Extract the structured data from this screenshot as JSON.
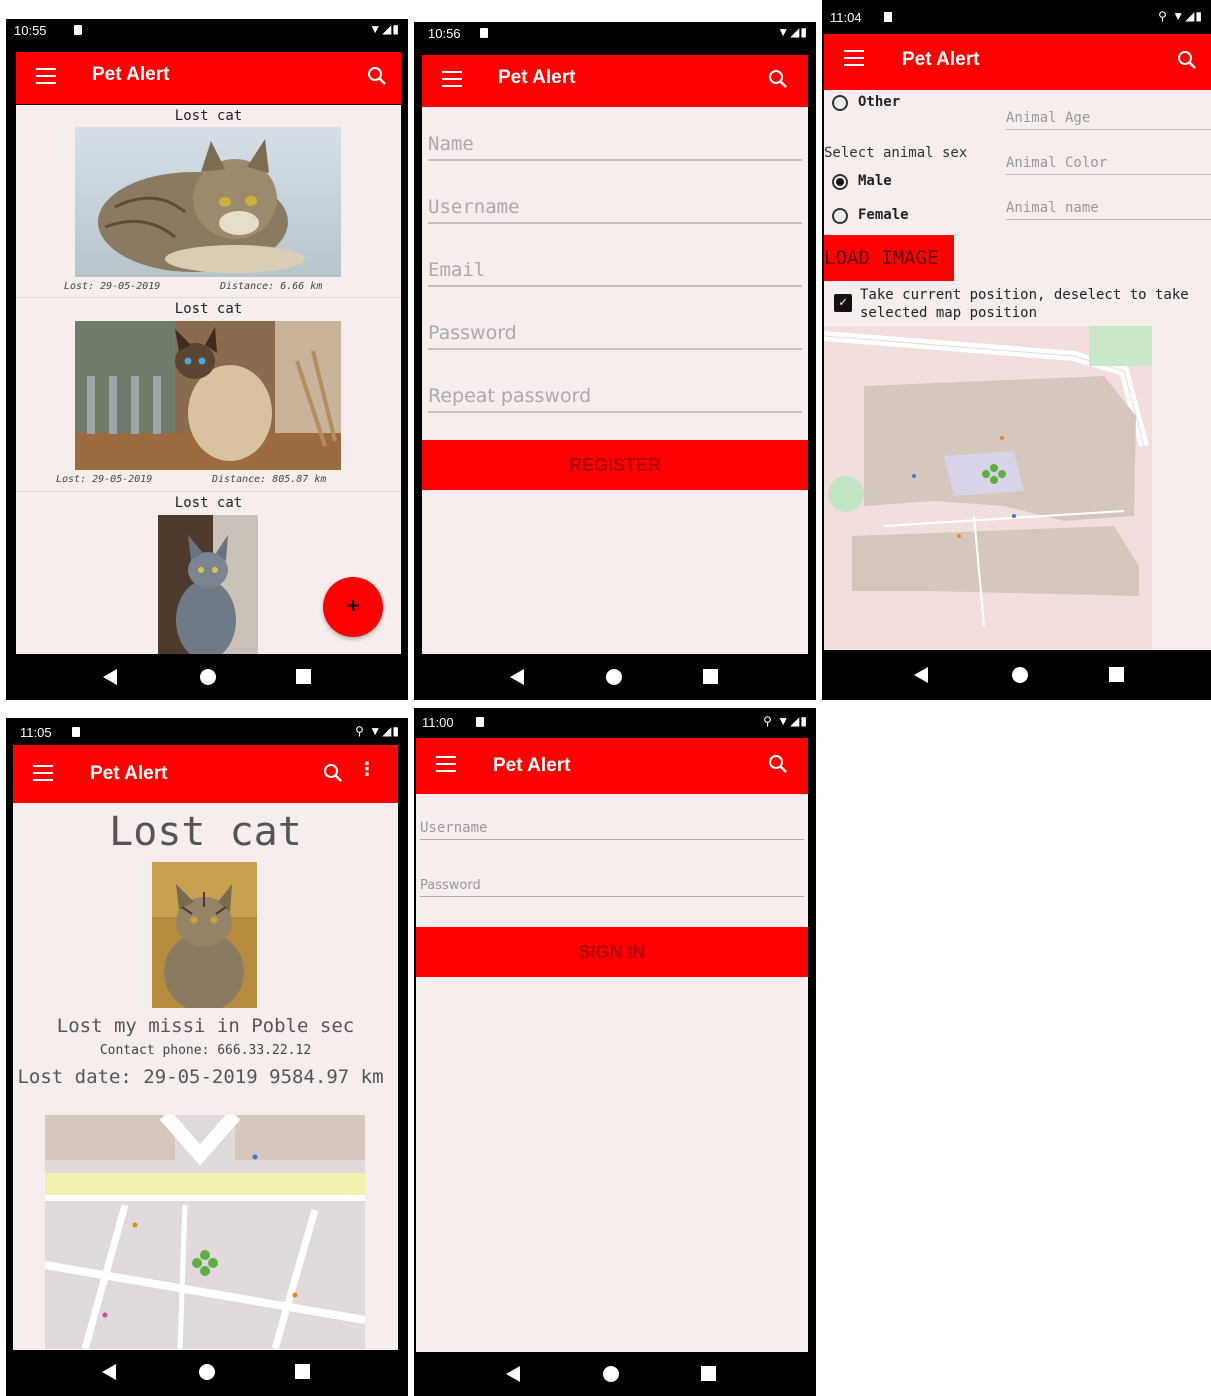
{
  "app_title": "Pet Alert",
  "status_icons": "▼◢▮",
  "status_icons_loc": "⚲ ▼◢▮",
  "screens": {
    "list": {
      "time": "10:55",
      "cards": [
        {
          "title": "Lost cat",
          "lost": "Lost: 29-05-2019",
          "distance": "Distance: 6.66 km"
        },
        {
          "title": "Lost cat",
          "lost": "Lost: 29-05-2019",
          "distance": "Distance: 805.87 km"
        },
        {
          "title": "Lost cat"
        }
      ],
      "fab_label": "+"
    },
    "register": {
      "time": "10:56",
      "placeholders": {
        "name": "Name",
        "username": "Username",
        "email": "Email",
        "password": "Password",
        "repeat_password": "Repeat password"
      },
      "button": "REGISTER"
    },
    "report": {
      "time": "11:04",
      "radio_other": "Other",
      "sex_label": "Select animal sex",
      "radio_male": "Male",
      "radio_female": "Female",
      "age_placeholder": "Animal Age",
      "color_placeholder": "Animal Color",
      "name_placeholder": "Animal name",
      "load_image": "LOAD IMAGE",
      "checkbox_label": "Take current position, deselect to take selected map position"
    },
    "detail": {
      "time": "11:05",
      "title": "Lost cat",
      "description": "Lost my missi in Poble sec",
      "phone": "Contact phone: 666.33.22.12",
      "lost_date": "Lost date: 29-05-2019 9584.97 km"
    },
    "login": {
      "time": "11:00",
      "username_placeholder": "Username",
      "password_placeholder": "Password",
      "button": "SIGN IN"
    }
  },
  "colors": {
    "accent": "#ff0000",
    "background": "#f8eded",
    "bars": "#000000"
  }
}
